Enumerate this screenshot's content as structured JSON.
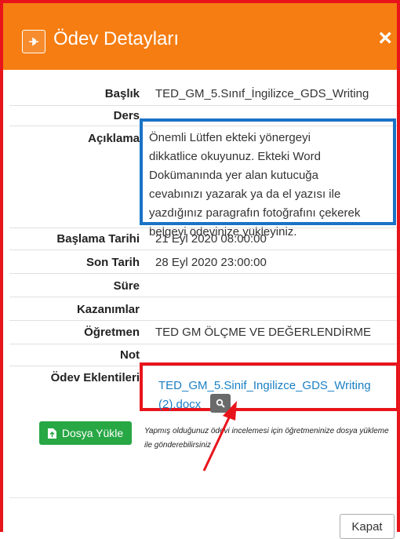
{
  "header": {
    "title": "Ödev Detayları",
    "close_label": "×"
  },
  "details": {
    "title_label": "Başlık",
    "title_value": "TED_GM_5.Sınıf_İngilizce_GDS_Writing",
    "course_label": "Ders",
    "description_label": "Açıklama",
    "description_value": "Önemli Lütfen ekteki yönergeyi dikkatlice okuyunuz. Ekteki Word Dokümanında yer alan kutucuğa cevabınızı yazarak ya da el yazısı ile yazdığınız paragrafın fotoğrafını çekerek belgeyi ödevinize yükleyiniz.",
    "start_date_label": "Başlama Tarihi",
    "start_date_value": "21 Eyl 2020 08:00:00",
    "end_date_label": "Son Tarih",
    "end_date_value": "28 Eyl 2020 23:00:00",
    "duration_label": "Süre",
    "outcomes_label": "Kazanımlar",
    "teacher_label": "Öğretmen",
    "teacher_value": "TED GM ÖLÇME VE DEĞERLENDİRME",
    "note_label": "Not",
    "attachments_label": "Ödev Eklentileri",
    "attachment_line1": "TED_GM_5.Sinif_Ingilizce_GDS_Writing",
    "attachment_line2": "(2).docx"
  },
  "upload": {
    "button_label": "Dosya Yükle",
    "note": "Yapmış olduğunuz ödevi incelemesi için öğretmeninize dosya yükleme ile gönderebilirsiniz"
  },
  "footer": {
    "close_button": "Kapat"
  },
  "colors": {
    "header": "#f57d12",
    "annotation_red": "#e8141b",
    "annotation_blue": "#1a73c6",
    "link": "#1b80c4",
    "upload_green": "#28a745"
  }
}
